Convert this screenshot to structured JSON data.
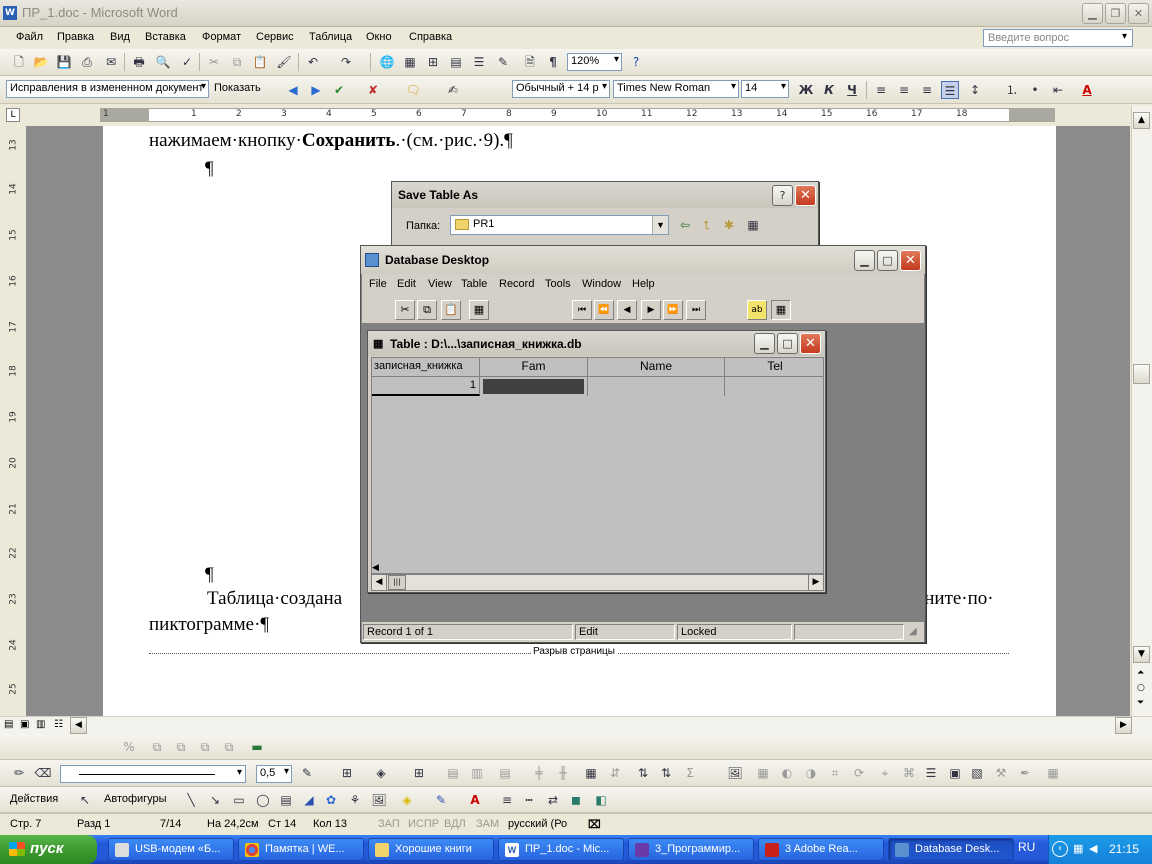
{
  "window": {
    "title": "ПР_1.doc - Microsoft Word",
    "icon": "W"
  },
  "menu": [
    "Файл",
    "Правка",
    "Вид",
    "Вставка",
    "Формат",
    "Сервис",
    "Таблица",
    "Окно",
    "Справка"
  ],
  "ask_placeholder": "Введите вопрос",
  "toolbar_std": {
    "zoom": "120%"
  },
  "toolbar_fmt": {
    "track": "Исправления в измененном документ",
    "show": "Показать",
    "style": "Обычный + 14 р",
    "font": "Times New Roman",
    "size": "14",
    "bold": "Ж",
    "italic": "К",
    "underline": "Ч"
  },
  "ruler_h": [
    "1",
    "1",
    "2",
    "3",
    "4",
    "5",
    "6",
    "7",
    "8",
    "9",
    "10",
    "11",
    "12",
    "13",
    "14",
    "15",
    "16",
    "17",
    "18"
  ],
  "ruler_v": [
    "13",
    "14",
    "15",
    "16",
    "17",
    "18",
    "19",
    "20",
    "21",
    "22",
    "23",
    "24",
    "25"
  ],
  "doc": {
    "line1_a": "нажимаем·кнопку·",
    "line1_b": "Сохранить",
    "line1_c": ".·(см.·рис.·9).¶",
    "pilcrow1": "¶",
    "pilcrow2": "¶",
    "line2_a": "Таблица·создана",
    "line2_b": "кните·по·",
    "line3": "пиктограмме·¶",
    "page_break": "Разрыв страницы"
  },
  "save_dialog": {
    "title": "Save Table As",
    "folder_label": "Папка:",
    "folder_value": "PR1",
    "help": "?",
    "close": "✕"
  },
  "db_window": {
    "title": "Database Desktop",
    "menu": [
      "File",
      "Edit",
      "View",
      "Table",
      "Record",
      "Tools",
      "Window",
      "Help"
    ],
    "status": {
      "record": "Record 1 of 1",
      "mode": "Edit",
      "lock": "Locked"
    }
  },
  "table_window": {
    "title": "Table : D:\\...\\записная_книжка.db",
    "columns": [
      "записная_книжка",
      "Fam",
      "Name",
      "Tel"
    ],
    "rows": [
      [
        "1",
        "",
        "",
        ""
      ]
    ]
  },
  "status": {
    "page": "Стр. 7",
    "section": "Разд 1",
    "pages": "7/14",
    "at": "На 24,2см",
    "line": "Ст 14",
    "col": "Кол 13",
    "rec": "ЗАП",
    "trk": "ИСПР",
    "ext": "ВДЛ",
    "ovr": "ЗАМ",
    "lang": "русский (Ро"
  },
  "drawing": {
    "actions": "Действия",
    "autoshapes": "Автофигуры",
    "line_width": "0,5"
  },
  "taskbar": {
    "start": "пуск",
    "items": [
      "USB-модем «Б...",
      "Памятка | WE...",
      "Хорошие книги",
      "ПР_1.doc - Mic...",
      "3_Программир...",
      "3 Adobe Rea...",
      "Database Desk..."
    ],
    "lang": "RU",
    "clock": "21:15"
  },
  "colors": {
    "accent": "#245ad9",
    "start_green": "#3c9a2f",
    "close_red": "#c4391e"
  }
}
